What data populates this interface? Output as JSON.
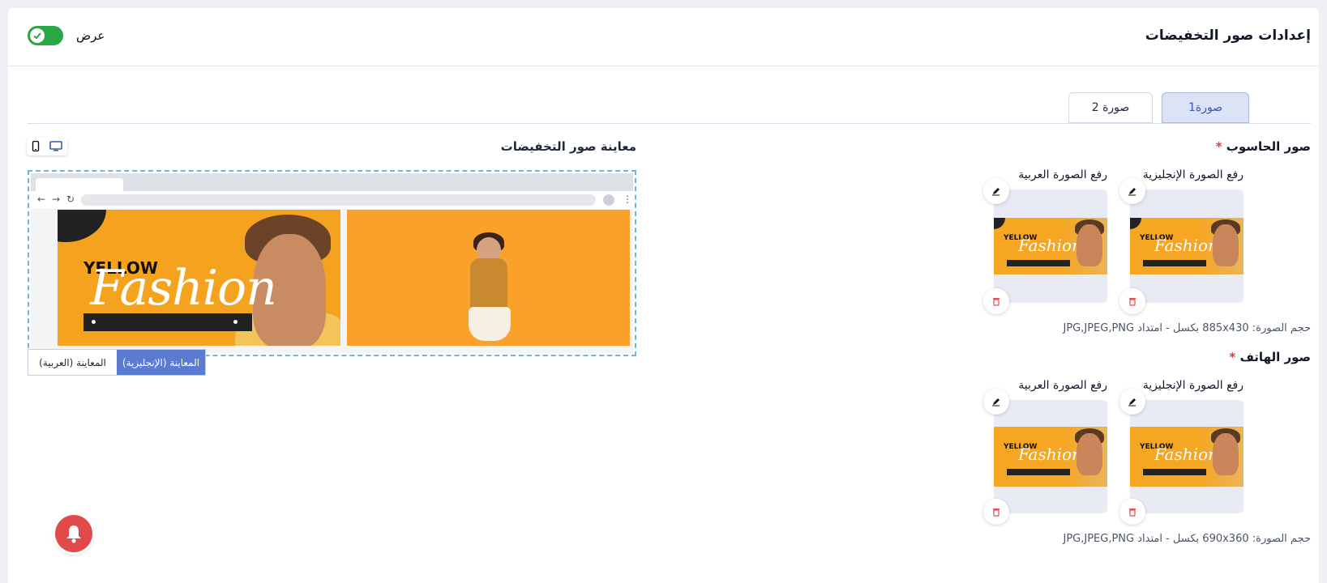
{
  "header": {
    "title": "إعدادات صور التخفيضات",
    "toggle_label": "عرض",
    "toggle_on": true
  },
  "tabs": [
    {
      "label": "صورة1",
      "active": true
    },
    {
      "label": "صورة 2",
      "active": false
    }
  ],
  "desktop": {
    "section_label": "صور الحاسوب",
    "required": "*",
    "english_upload_label": "رفع الصورة الإنجليزية",
    "arabic_upload_label": "رفع الصورة العربية",
    "hint": "حجم الصورة: 885x430 بكسل - امتداد JPG,JPEG,PNG"
  },
  "mobile": {
    "section_label": "صور الهاتف",
    "required": "*",
    "english_upload_label": "رفع الصورة الإنجليزية",
    "arabic_upload_label": "رفع الصورة العربية",
    "hint": "حجم الصورة: 690x360 بكسل - امتداد JPG,JPEG,PNG"
  },
  "banner_text": {
    "yellow": "YELLOW",
    "fashion": "Fashion"
  },
  "preview": {
    "title": "معاينة صور التخفيضات",
    "english_button": "المعاينة (الإنجليزية)",
    "arabic_button": "المعاينة (العربية)",
    "active_language": "english",
    "device": "desktop"
  },
  "colors": {
    "accent": "#5a7bd0",
    "toggle": "#28a745",
    "danger": "#e24a4a"
  },
  "icons": [
    "check-icon",
    "edit-icon",
    "trash-icon",
    "mobile-icon",
    "desktop-icon",
    "bell-icon"
  ]
}
